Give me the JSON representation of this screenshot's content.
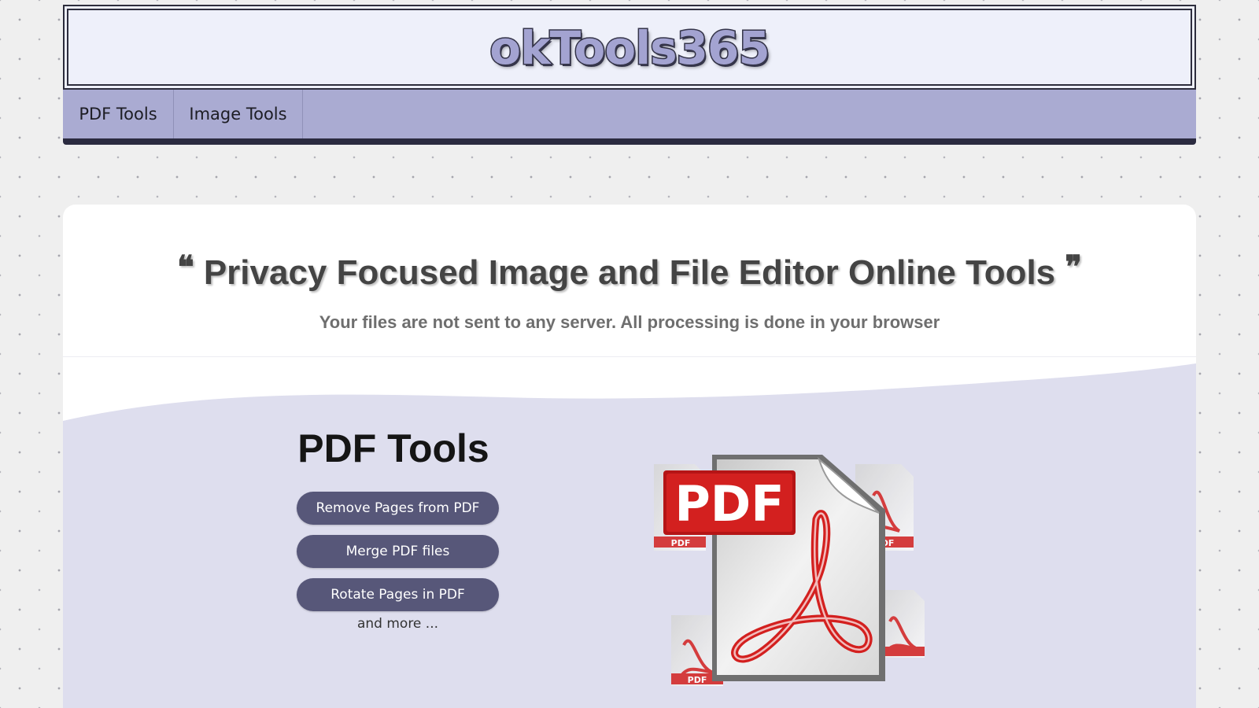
{
  "header": {
    "logo_text": "okTools365"
  },
  "nav": {
    "items": [
      {
        "label": "PDF Tools"
      },
      {
        "label": "Image Tools"
      }
    ]
  },
  "hero": {
    "open_quote": "❝",
    "title": "Privacy Focused Image and File Editor Online Tools",
    "close_quote": "❞",
    "subtitle": "Your files are not sent to any server. All processing is done in your browser"
  },
  "pdf_section": {
    "heading": "PDF Tools",
    "buttons": [
      {
        "label": "Remove Pages from PDF"
      },
      {
        "label": "Merge PDF files"
      },
      {
        "label": "Rotate Pages in PDF"
      }
    ],
    "more_text": "and more ...",
    "illustration": {
      "icon": "pdf-document-icon",
      "badge_text": "PDF",
      "small_badge_text": "PDF"
    }
  },
  "colors": {
    "page_bg": "#efefef",
    "header_bg": "#eef0fa",
    "nav_bg": "#aaabd2",
    "nav_border": "#2b2b40",
    "button_bg": "#575779",
    "wave_bg": "#dedeee",
    "pdf_red": "#d3201f"
  }
}
